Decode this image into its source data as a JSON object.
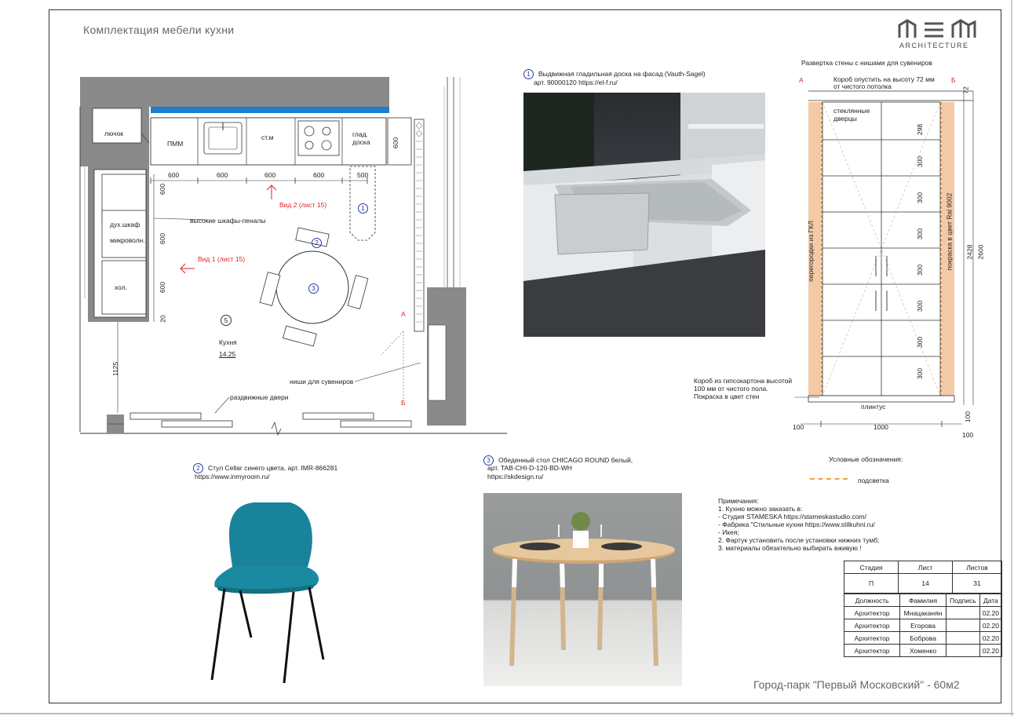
{
  "sheet_title": "Комплектация мебели кухни",
  "logo": {
    "mark": "MEM",
    "text": "ARCHITECTURE"
  },
  "plan": {
    "labels": {
      "luchok": "лючок",
      "pmm": "ПММ",
      "stm": "ст.м",
      "glad1": "глад.",
      "glad2": "доска",
      "dukh": "дух.шкаф",
      "micro": "микроволн.",
      "khol": "хол.",
      "tall": "высокие шкафы-пеналы",
      "view2": "Вид 2 (лист 15)",
      "view1": "Вид 1 (лист 15)",
      "room_num": "5",
      "room_name": "Кухня",
      "room_area": "14.25",
      "niches": "ниши для сувениров",
      "sliding": "раздвижные двери",
      "a": "А",
      "b": "Б"
    },
    "dims_top": [
      "600",
      "600",
      "600",
      "600",
      "500"
    ],
    "dim_side600": "600",
    "dims_left": [
      "600",
      "600",
      "600",
      "20"
    ],
    "dim_1125": "1125",
    "markers": [
      "1",
      "2",
      "3"
    ]
  },
  "item1": {
    "num": "1",
    "title": "Выдвижная гладильная доска на фасад (Vauth-Sagel)",
    "art": "арт. 90000120 https://el-f.ru/"
  },
  "item2": {
    "num": "2",
    "title": "Стул Cellar синего цвета, арт. IMR-866281",
    "url": "https://www.inmyroom.ru/"
  },
  "item3": {
    "num": "3",
    "title": "Обеденный стол CHICAGO ROUND белый,",
    "art": "арт. TAB-CHI-D-120-BD-WH",
    "url": "https://skdesign.ru/"
  },
  "elevation": {
    "title": "Развертка стены с нишами для сувениров",
    "a": "А",
    "b": "Б",
    "box_note1": "Короб опустить на высоту 72 мм",
    "box_note2": "от чистого потолка",
    "glass1": "стеклянные",
    "glass2": "дверцы",
    "left_v": "перегородки из ГКЛ",
    "right_v": "покраска в цвет Ral 9002",
    "dims_right": [
      "298",
      "300",
      "300",
      "300",
      "300",
      "300",
      "300",
      "300"
    ],
    "d72": "72",
    "d2428": "2428",
    "d2600": "2600",
    "d100": "100",
    "floor1": "Короб из гипсокартона высотой",
    "floor2": "100 мм от чистого пола.",
    "floor3": "Покраска в цвет стен",
    "plinth": "плинтус",
    "bottom": [
      "100",
      "1000",
      "100"
    ]
  },
  "legend": {
    "title": "Условные обозначения:",
    "item": "подсветка",
    "color": "#f0a040"
  },
  "notes": {
    "title": "Примечания:",
    "lines": [
      "1. Кухню можно заказать в:",
      "- Студия STAMESKA https://stameskastudio.com/",
      "- Фабрика \"Стильные кухни https://www.stilkuhni.ru/",
      "- Икея;",
      "2. Фартук установить после установки нижних тумб;",
      "3. материалы обязательно выбирать вживую !"
    ]
  },
  "stamp": {
    "head": [
      "Стадия",
      "Лист",
      "Листов"
    ],
    "vals": [
      "П",
      "14",
      "31"
    ],
    "cols": [
      "Должность",
      "Фамилия",
      "Подпись",
      "Дата"
    ],
    "rows": [
      [
        "Архитектор",
        "Мнацаканян",
        "",
        "02.20"
      ],
      [
        "Архитектор",
        "Егорова",
        "",
        "02.20"
      ],
      [
        "Архитектор",
        "Боброва",
        "",
        "02.20"
      ],
      [
        "Архитектор",
        "Хоменко",
        "",
        "02.20"
      ]
    ]
  },
  "footer": "Город-парк \"Первый Московский\" - 60м2"
}
